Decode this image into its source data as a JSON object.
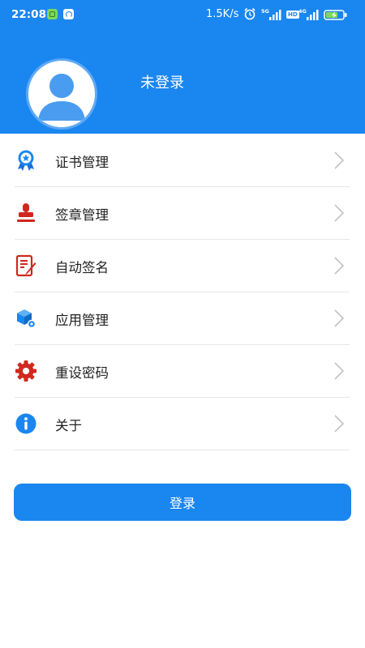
{
  "status_bar": {
    "time": "22:08",
    "network_speed": "1.5K/s",
    "signal1_label": "5G",
    "hd_label": "HD",
    "signal2_label": "4G",
    "icons": [
      "app-notification-icon",
      "browser-icon",
      "alarm-icon",
      "signal-icon",
      "hd-icon",
      "signal-icon",
      "battery-charging-icon"
    ]
  },
  "profile": {
    "name": "未登录"
  },
  "menu": {
    "items": [
      {
        "label": "证书管理",
        "icon": "certificate-badge-icon"
      },
      {
        "label": "签章管理",
        "icon": "stamp-icon"
      },
      {
        "label": "自动签名",
        "icon": "signature-document-icon"
      },
      {
        "label": "应用管理",
        "icon": "app-cube-settings-icon"
      },
      {
        "label": "重设密码",
        "icon": "gear-icon"
      },
      {
        "label": "关于",
        "icon": "info-icon"
      }
    ]
  },
  "login_button": {
    "label": "登录"
  },
  "colors": {
    "primary": "#1a86f0",
    "stamp_red": "#d0281f",
    "divider": "#e6e6e6"
  }
}
